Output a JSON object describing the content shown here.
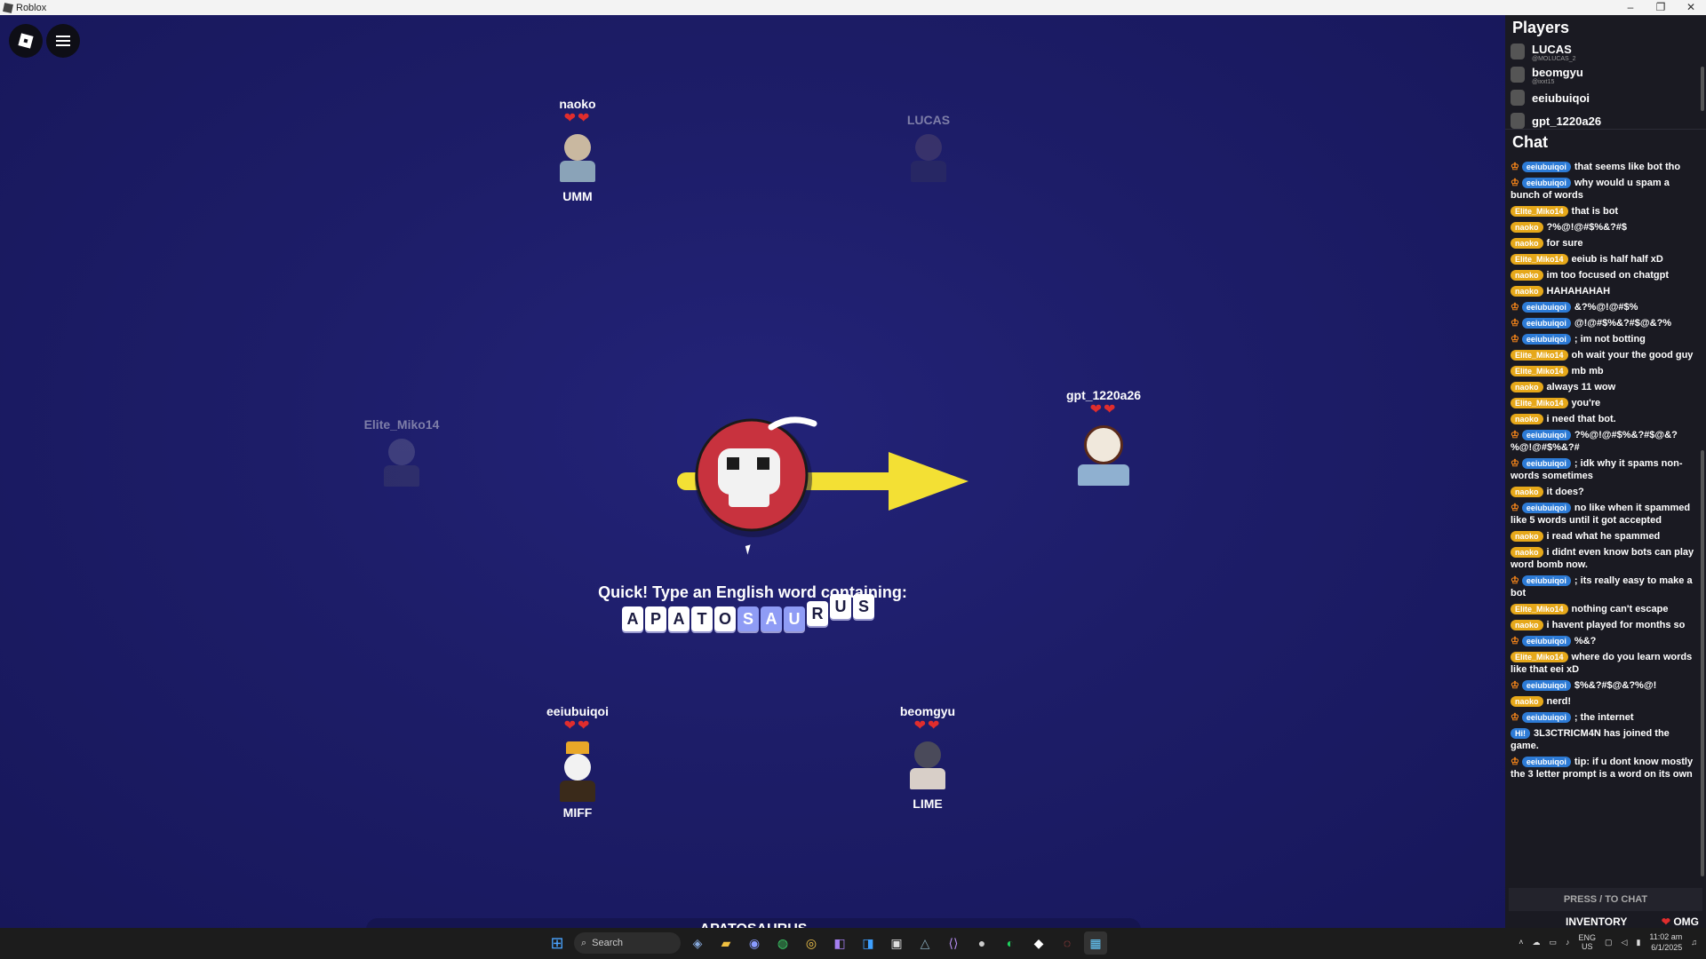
{
  "window": {
    "title": "Roblox",
    "minimize": "–",
    "restore": "❐",
    "close": "✕"
  },
  "game": {
    "players": [
      {
        "name": "naoko",
        "hearts": "❤❤",
        "word": "UMM",
        "faded": false
      },
      {
        "name": "LUCAS",
        "hearts": "",
        "word": "",
        "faded": true
      },
      {
        "name": "Elite_Miko14",
        "hearts": "",
        "word": "",
        "faded": true
      },
      {
        "name": "gpt_1220a26",
        "hearts": "❤❤",
        "word": "",
        "faded": false
      },
      {
        "name": "eeiubuiqoi",
        "hearts": "❤❤",
        "word": "MIFF",
        "faded": false
      },
      {
        "name": "beomgyu",
        "hearts": "❤❤",
        "word": "LIME",
        "faded": false
      }
    ],
    "prompt": "Quick! Type an English word containing:",
    "tiles": [
      "A",
      "P",
      "A",
      "T",
      "O",
      "S",
      "A",
      "U",
      "R",
      "U",
      "S"
    ],
    "highlighted_tiles": [
      5,
      6,
      7
    ],
    "input_value": "APATOSAURUS",
    "colors": {
      "arrow": "#f3e034",
      "bomb": "#c8323e",
      "heart": "#e02d2d",
      "tile_highlight": "#8f9cf5"
    }
  },
  "sidebar": {
    "players_title": "Players",
    "players": [
      {
        "name": "LUCAS",
        "sub": "@MOLUCAS_2"
      },
      {
        "name": "beomgyu",
        "sub": "@ixxt15"
      },
      {
        "name": "eeiubuiqoi",
        "sub": ""
      },
      {
        "name": "gpt_1220a26",
        "sub": ""
      }
    ],
    "chat_title": "Chat",
    "messages": [
      {
        "user": "eeiubuiqoi",
        "crown": true,
        "text": "that seems like bot tho"
      },
      {
        "user": "eeiubuiqoi",
        "crown": true,
        "text": "why would u spam a bunch of words"
      },
      {
        "user": "Elite_Miko14",
        "crown": false,
        "text": "that is bot"
      },
      {
        "user": "naoko",
        "crown": false,
        "text": "?%@!@#$%&?#$"
      },
      {
        "user": "naoko",
        "crown": false,
        "text": "for sure"
      },
      {
        "user": "Elite_Miko14",
        "crown": false,
        "text": "eeiub is half half xD"
      },
      {
        "user": "naoko",
        "crown": false,
        "text": "im too focused on chatgpt"
      },
      {
        "user": "naoko",
        "crown": false,
        "text": "HAHAHAHAH"
      },
      {
        "user": "eeiubuiqoi",
        "crown": true,
        "text": "&?%@!@#$%"
      },
      {
        "user": "eeiubuiqoi",
        "crown": true,
        "text": "@!@#$%&?#$@&?%"
      },
      {
        "user": "eeiubuiqoi",
        "crown": true,
        "text": "; im not botting"
      },
      {
        "user": "Elite_Miko14",
        "crown": false,
        "text": "oh wait your the good guy"
      },
      {
        "user": "Elite_Miko14",
        "crown": false,
        "text": "mb mb"
      },
      {
        "user": "naoko",
        "crown": false,
        "text": "always 11 wow"
      },
      {
        "user": "Elite_Miko14",
        "crown": false,
        "text": "you're"
      },
      {
        "user": "naoko",
        "crown": false,
        "text": "i need that bot."
      },
      {
        "user": "eeiubuiqoi",
        "crown": true,
        "text": "?%@!@#$%&?#$@&?%@!@#$%&?#"
      },
      {
        "user": "eeiubuiqoi",
        "crown": true,
        "text": "; idk why it spams non-words sometimes"
      },
      {
        "user": "naoko",
        "crown": false,
        "text": "it does?"
      },
      {
        "user": "eeiubuiqoi",
        "crown": true,
        "text": "no like when it spammed like 5 words until it got accepted"
      },
      {
        "user": "naoko",
        "crown": false,
        "text": "i read what he spammed"
      },
      {
        "user": "naoko",
        "crown": false,
        "text": "i didnt even know bots can play word bomb now."
      },
      {
        "user": "eeiubuiqoi",
        "crown": true,
        "text": "; its really easy to make a bot"
      },
      {
        "user": "Elite_Miko14",
        "crown": false,
        "text": "nothing can't escape"
      },
      {
        "user": "naoko",
        "crown": false,
        "text": "i havent played for months so"
      },
      {
        "user": "eeiubuiqoi",
        "crown": true,
        "text": "%&?"
      },
      {
        "user": "Elite_Miko14",
        "crown": false,
        "text": "where do you learn words like that eei xD"
      },
      {
        "user": "eeiubuiqoi",
        "crown": true,
        "text": "$%&?#$@&?%@!"
      },
      {
        "user": "naoko",
        "crown": false,
        "text": "nerd!"
      },
      {
        "user": "eeiubuiqoi",
        "crown": true,
        "text": "; the internet"
      },
      {
        "user": "Hi!",
        "crown": false,
        "text": "3L3CTRICM4N has joined the game."
      },
      {
        "user": "eeiubuiqoi",
        "crown": true,
        "text": "tip: if u dont know mostly the 3 letter prompt is a word on its own"
      }
    ],
    "press_to_chat": "PRESS / TO CHAT",
    "inventory": "INVENTORY",
    "omg": "OMG"
  },
  "taskbar": {
    "search_placeholder": "Search",
    "lang_top": "ENG",
    "lang_bottom": "US",
    "time": "11:02 am",
    "date": "6/1/2025"
  }
}
